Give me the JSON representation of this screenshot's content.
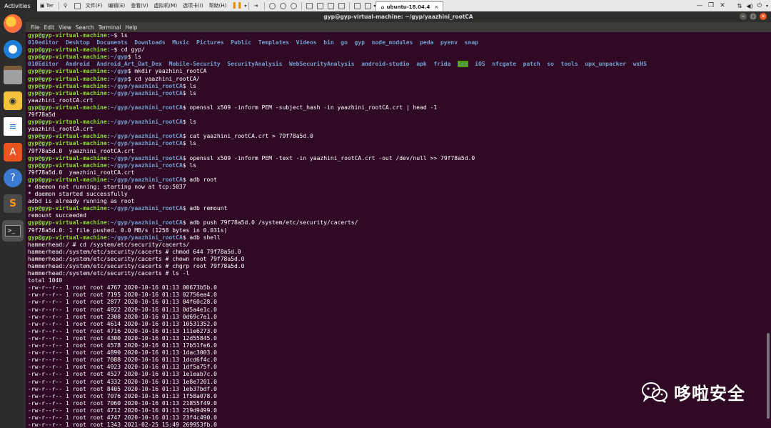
{
  "topbar": {
    "activities": "Activities",
    "app_title": "Ter",
    "vm_menu": [
      "文件(F)",
      "编辑(E)",
      "查看(V)",
      "虚拟机(M)",
      "选项卡(I)",
      "帮助(H)"
    ],
    "vm_tab": "ubuntu-18.04.4",
    "tab_close": "×"
  },
  "terminal": {
    "title": "gyp@gyp-virtual-machine: ~/gyp/yaazhini_rootCA",
    "menu": [
      "File",
      "Edit",
      "View",
      "Search",
      "Terminal",
      "Help"
    ]
  },
  "watermark": {
    "text": "哆啦安全"
  },
  "lines": [
    [
      [
        "u",
        "gyp@gyp-virtual-machine"
      ],
      [
        "t",
        ":"
      ],
      [
        "p",
        "~"
      ],
      [
        "t",
        "$ ls"
      ]
    ],
    [
      [
        "d",
        "010editor  Desktop  Documents  Downloads  Music  Pictures  Public  Templates  Videos  bin  go  gyp  node_modules  peda  pyenv  snap"
      ]
    ],
    [
      [
        "u",
        "gyp@gyp-virtual-machine"
      ],
      [
        "t",
        ":"
      ],
      [
        "p",
        "~"
      ],
      [
        "t",
        "$ cd gyp/"
      ]
    ],
    [
      [
        "u",
        "gyp@gyp-virtual-machine"
      ],
      [
        "t",
        ":"
      ],
      [
        "p",
        "~/gyp"
      ],
      [
        "t",
        "$ ls"
      ]
    ],
    [
      [
        "d",
        "010Editor  Android  Android_Art_Oat_Dex  Mobile-Security  SecurityAnalysis  WebSecurityAnalysis  android-studio  apk  frida  "
      ],
      [
        "h",
        "ios"
      ],
      [
        "d",
        "  iOS  nfcgate  patch  so  tools  upx_unpacker  wxHS"
      ]
    ],
    [
      [
        "u",
        "gyp@gyp-virtual-machine"
      ],
      [
        "t",
        ":"
      ],
      [
        "p",
        "~/gyp"
      ],
      [
        "t",
        "$ mkdir yaazhini_rootCA"
      ]
    ],
    [
      [
        "u",
        "gyp@gyp-virtual-machine"
      ],
      [
        "t",
        ":"
      ],
      [
        "p",
        "~/gyp"
      ],
      [
        "t",
        "$ cd yaazhini_rootCA/"
      ]
    ],
    [
      [
        "u",
        "gyp@gyp-virtual-machine"
      ],
      [
        "t",
        ":"
      ],
      [
        "p",
        "~/gyp/yaazhini_rootCA"
      ],
      [
        "t",
        "$ ls"
      ]
    ],
    [
      [
        "u",
        "gyp@gyp-virtual-machine"
      ],
      [
        "t",
        ":"
      ],
      [
        "p",
        "~/gyp/yaazhini_rootCA"
      ],
      [
        "t",
        "$ ls"
      ]
    ],
    [
      [
        "t",
        "yaazhini_rootCA.crt"
      ]
    ],
    [
      [
        "u",
        "gyp@gyp-virtual-machine"
      ],
      [
        "t",
        ":"
      ],
      [
        "p",
        "~/gyp/yaazhini_rootCA"
      ],
      [
        "t",
        "$ openssl x509 -inform PEM -subject_hash -in yaazhini_rootCA.crt | head -1"
      ]
    ],
    [
      [
        "t",
        "79f78a5d"
      ]
    ],
    [
      [
        "u",
        "gyp@gyp-virtual-machine"
      ],
      [
        "t",
        ":"
      ],
      [
        "p",
        "~/gyp/yaazhini_rootCA"
      ],
      [
        "t",
        "$ ls"
      ]
    ],
    [
      [
        "t",
        "yaazhini_rootCA.crt"
      ]
    ],
    [
      [
        "u",
        "gyp@gyp-virtual-machine"
      ],
      [
        "t",
        ":"
      ],
      [
        "p",
        "~/gyp/yaazhini_rootCA"
      ],
      [
        "t",
        "$ cat yaazhini_rootCA.crt > 79f78a5d.0"
      ]
    ],
    [
      [
        "u",
        "gyp@gyp-virtual-machine"
      ],
      [
        "t",
        ":"
      ],
      [
        "p",
        "~/gyp/yaazhini_rootCA"
      ],
      [
        "t",
        "$ ls"
      ]
    ],
    [
      [
        "t",
        "79f78a5d.0  yaazhini_rootCA.crt"
      ]
    ],
    [
      [
        "u",
        "gyp@gyp-virtual-machine"
      ],
      [
        "t",
        ":"
      ],
      [
        "p",
        "~/gyp/yaazhini_rootCA"
      ],
      [
        "t",
        "$ openssl x509 -inform PEM -text -in yaazhini_rootCA.crt -out /dev/null >> 79f78a5d.0"
      ]
    ],
    [
      [
        "u",
        "gyp@gyp-virtual-machine"
      ],
      [
        "t",
        ":"
      ],
      [
        "p",
        "~/gyp/yaazhini_rootCA"
      ],
      [
        "t",
        "$ ls"
      ]
    ],
    [
      [
        "t",
        "79f78a5d.0  yaazhini_rootCA.crt"
      ]
    ],
    [
      [
        "u",
        "gyp@gyp-virtual-machine"
      ],
      [
        "t",
        ":"
      ],
      [
        "p",
        "~/gyp/yaazhini_rootCA"
      ],
      [
        "t",
        "$ adb root"
      ]
    ],
    [
      [
        "t",
        "* daemon not running; starting now at tcp:5037"
      ]
    ],
    [
      [
        "t",
        "* daemon started successfully"
      ]
    ],
    [
      [
        "t",
        "adbd is already running as root"
      ]
    ],
    [
      [
        "u",
        "gyp@gyp-virtual-machine"
      ],
      [
        "t",
        ":"
      ],
      [
        "p",
        "~/gyp/yaazhini_rootCA"
      ],
      [
        "t",
        "$ adb remount"
      ]
    ],
    [
      [
        "t",
        "remount succeeded"
      ]
    ],
    [
      [
        "u",
        "gyp@gyp-virtual-machine"
      ],
      [
        "t",
        ":"
      ],
      [
        "p",
        "~/gyp/yaazhini_rootCA"
      ],
      [
        "t",
        "$ adb push 79f78a5d.0 /system/etc/security/cacerts/"
      ]
    ],
    [
      [
        "t",
        "79f78a5d.0: 1 file pushed. 0.0 MB/s (1258 bytes in 0.031s)"
      ]
    ],
    [
      [
        "u",
        "gyp@gyp-virtual-machine"
      ],
      [
        "t",
        ":"
      ],
      [
        "p",
        "~/gyp/yaazhini_rootCA"
      ],
      [
        "t",
        "$ adb shell"
      ]
    ],
    [
      [
        "t",
        "hammerhead:/ # cd /system/etc/security/cacerts/"
      ]
    ],
    [
      [
        "t",
        "hammerhead:/system/etc/security/cacerts # chmod 644 79f78a5d.0"
      ]
    ],
    [
      [
        "t",
        "hammerhead:/system/etc/security/cacerts # chown root 79f78a5d.0"
      ]
    ],
    [
      [
        "t",
        "hammerhead:/system/etc/security/cacerts # chgrp root 79f78a5d.0"
      ]
    ],
    [
      [
        "t",
        "hammerhead:/system/etc/security/cacerts # ls -l"
      ]
    ],
    [
      [
        "t",
        "total 1040"
      ]
    ],
    [
      [
        "t",
        "-rw-r--r-- 1 root root 4767 2020-10-16 01:13 00673b5b.0"
      ]
    ],
    [
      [
        "t",
        "-rw-r--r-- 1 root root 7195 2020-10-16 01:13 02756ea4.0"
      ]
    ],
    [
      [
        "t",
        "-rw-r--r-- 1 root root 2877 2020-10-16 01:13 04f60c28.0"
      ]
    ],
    [
      [
        "t",
        "-rw-r--r-- 1 root root 4922 2020-10-16 01:13 0d5a4e1c.0"
      ]
    ],
    [
      [
        "t",
        "-rw-r--r-- 1 root root 2308 2020-10-16 01:13 0d69c7e1.0"
      ]
    ],
    [
      [
        "t",
        "-rw-r--r-- 1 root root 4614 2020-10-16 01:13 10531352.0"
      ]
    ],
    [
      [
        "t",
        "-rw-r--r-- 1 root root 4716 2020-10-16 01:13 111e6273.0"
      ]
    ],
    [
      [
        "t",
        "-rw-r--r-- 1 root root 4300 2020-10-16 01:13 12d55845.0"
      ]
    ],
    [
      [
        "t",
        "-rw-r--r-- 1 root root 4578 2020-10-16 01:13 17b51fe6.0"
      ]
    ],
    [
      [
        "t",
        "-rw-r--r-- 1 root root 4890 2020-10-16 01:13 1dac3003.0"
      ]
    ],
    [
      [
        "t",
        "-rw-r--r-- 1 root root 7088 2020-10-16 01:13 1dcd6f4c.0"
      ]
    ],
    [
      [
        "t",
        "-rw-r--r-- 1 root root 4923 2020-10-16 01:13 1df5a75f.0"
      ]
    ],
    [
      [
        "t",
        "-rw-r--r-- 1 root root 4527 2020-10-16 01:13 1e1eab7c.0"
      ]
    ],
    [
      [
        "t",
        "-rw-r--r-- 1 root root 4332 2020-10-16 01:13 1e8e7201.0"
      ]
    ],
    [
      [
        "t",
        "-rw-r--r-- 1 root root 8405 2020-10-16 01:13 1eb37bdf.0"
      ]
    ],
    [
      [
        "t",
        "-rw-r--r-- 1 root root 7076 2020-10-16 01:13 1f58a078.0"
      ]
    ],
    [
      [
        "t",
        "-rw-r--r-- 1 root root 7060 2020-10-16 01:13 21855f49.0"
      ]
    ],
    [
      [
        "t",
        "-rw-r--r-- 1 root root 4712 2020-10-16 01:13 219d9499.0"
      ]
    ],
    [
      [
        "t",
        "-rw-r--r-- 1 root root 4747 2020-10-16 01:13 23f4c490.0"
      ]
    ],
    [
      [
        "t",
        "-rw-r--r-- 1 root root 1343 2021-02-25 15:49 269953fb.0"
      ]
    ]
  ]
}
